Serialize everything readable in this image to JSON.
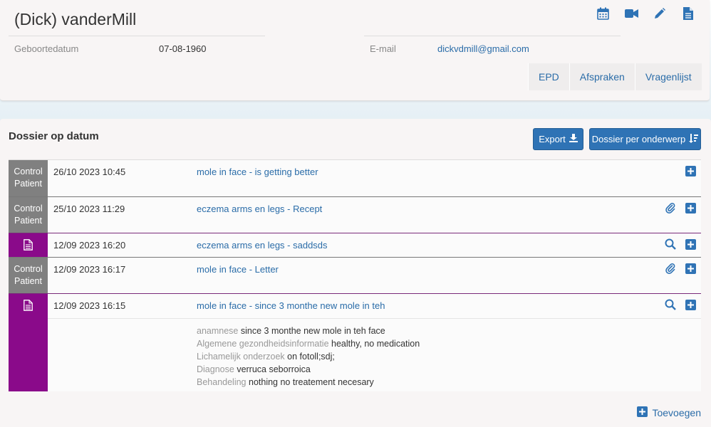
{
  "patient": {
    "name": "(Dick) vanderMill",
    "birthdate_label": "Geboortedatum",
    "birthdate": "07-08-1960",
    "email_label": "E-mail",
    "email": "dickvdmill@gmail.com"
  },
  "header_icons": [
    "calendar-icon",
    "video-camera-icon",
    "pencil-icon",
    "document-icon"
  ],
  "tabs": [
    {
      "label": "EPD"
    },
    {
      "label": "Afspraken"
    },
    {
      "label": "Vragenlijst"
    }
  ],
  "dossier": {
    "title": "Dossier op datum",
    "export_label": "Export",
    "by_subject_label": "Dossier per onderwerp",
    "add_label": "Toevoegen",
    "rows": [
      {
        "type_line1": "Control",
        "type_line2": "Patient",
        "date": "26/10 2023 10:45",
        "title": "mole in face - is getting better"
      },
      {
        "type_line1": "Control",
        "type_line2": "Patient",
        "date": "25/10 2023 11:29",
        "title": "eczema arms en legs - Recept"
      },
      {
        "type_line1": "",
        "type_line2": "",
        "date": "12/09 2023 16:20",
        "title": "eczema arms en legs - saddsds"
      },
      {
        "type_line1": "Control",
        "type_line2": "Patient",
        "date": "12/09 2023 16:17",
        "title": "mole in face - Letter"
      },
      {
        "type_line1": "",
        "type_line2": "",
        "date": "12/09 2023 16:15",
        "title": "mole in face - since 3 monthe new mole in teh"
      }
    ],
    "details": [
      {
        "label": "anamnese",
        "value": "since 3 monthe new mole in teh face"
      },
      {
        "label": "Algemene gezondheidsinformatie",
        "value": "healthy, no medication"
      },
      {
        "label": "Lichamelijk onderzoek",
        "value": "on fotoll;sdj;"
      },
      {
        "label": "Diagnose",
        "value": "verruca seborroica"
      },
      {
        "label": "Behandeling",
        "value": "nothing no treatement necesary"
      }
    ]
  },
  "colors": {
    "accent": "#2f73b5",
    "link": "#2a6ca8",
    "control_patient": "#808080",
    "document_type": "#8a0a8a"
  }
}
